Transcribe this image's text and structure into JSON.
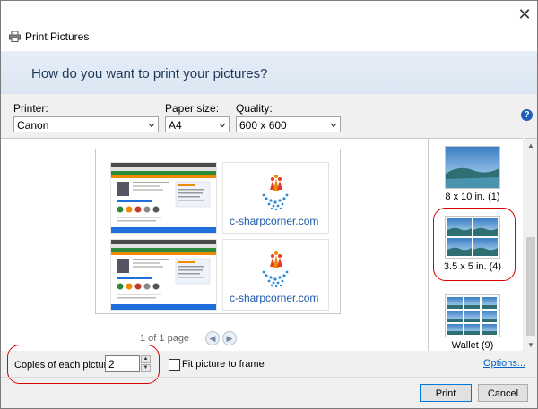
{
  "window": {
    "title": "Print Pictures",
    "close_glyph": "✕"
  },
  "header": {
    "question": "How do you want to print your pictures?"
  },
  "controls": {
    "printer_label": "Printer:",
    "printer_value": "Canon",
    "paper_label": "Paper size:",
    "paper_value": "A4",
    "quality_label": "Quality:",
    "quality_value": "600 x 600",
    "help_glyph": "?"
  },
  "preview": {
    "page_info": "1 of 1 page",
    "logo_text": "c-sharpcorner.com",
    "prev_glyph": "◀",
    "next_glyph": "▶"
  },
  "layouts": [
    {
      "label": "8 x 10 in. (1)",
      "selected": false
    },
    {
      "label": "3.5 x 5 in. (4)",
      "selected": true
    },
    {
      "label": "Wallet (9)",
      "selected": false
    }
  ],
  "footer": {
    "copies_label": "Copies of each picture:",
    "copies_value": "2",
    "fit_label": "Fit picture to frame",
    "fit_checked": false,
    "options_link": "Options...",
    "print_button": "Print",
    "cancel_button": "Cancel"
  },
  "colors": {
    "highlight": "#d80000",
    "header_text": "#1e3957",
    "link": "#0066cc"
  }
}
